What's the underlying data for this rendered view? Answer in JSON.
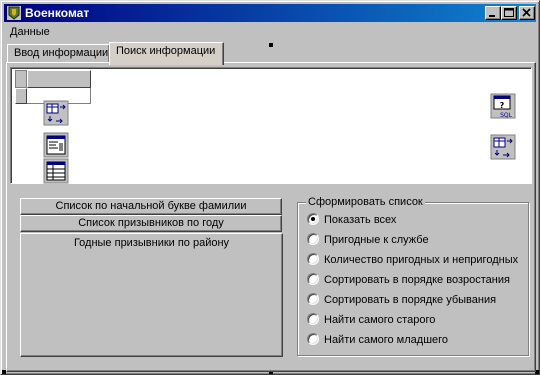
{
  "window": {
    "title": "Военкомат",
    "app_icon": "military-emblem-icon",
    "controls": [
      "minimize-icon",
      "maximize-icon",
      "close-icon"
    ]
  },
  "menu": {
    "items": [
      {
        "label": "Данные"
      }
    ]
  },
  "tabs": [
    {
      "label": "Ввод информации",
      "active": false
    },
    {
      "label": "Поиск информации",
      "active": true
    }
  ],
  "toolbar_icons": {
    "left": [
      "table-transfer-icon",
      "form-edit-icon",
      "grid-list-icon"
    ],
    "right": [
      "sql-query-icon",
      "table-transfer-icon"
    ]
  },
  "lists": {
    "buttons": [
      {
        "label": "Список по начальной букве фамилии"
      },
      {
        "label": "Список призывников по году"
      }
    ],
    "panel_title": "Годные призывники по району"
  },
  "form_list": {
    "legend": "Сформировать список",
    "options": [
      {
        "label": "Показать всех",
        "checked": true
      },
      {
        "label": "Пригодные к службе",
        "checked": false
      },
      {
        "label": "Количество пригодных и непригодных",
        "checked": false
      },
      {
        "label": "Сортировать в порядке возростания",
        "checked": false
      },
      {
        "label": "Сортировать в порядке убывания",
        "checked": false
      },
      {
        "label": "Найти самого старого",
        "checked": false
      },
      {
        "label": "Найти самого младшего",
        "checked": false
      }
    ]
  },
  "colors": {
    "title_start": "#000080",
    "title_end": "#1084d0",
    "face": "#c0c0c0",
    "icon_blue": "#000080"
  }
}
